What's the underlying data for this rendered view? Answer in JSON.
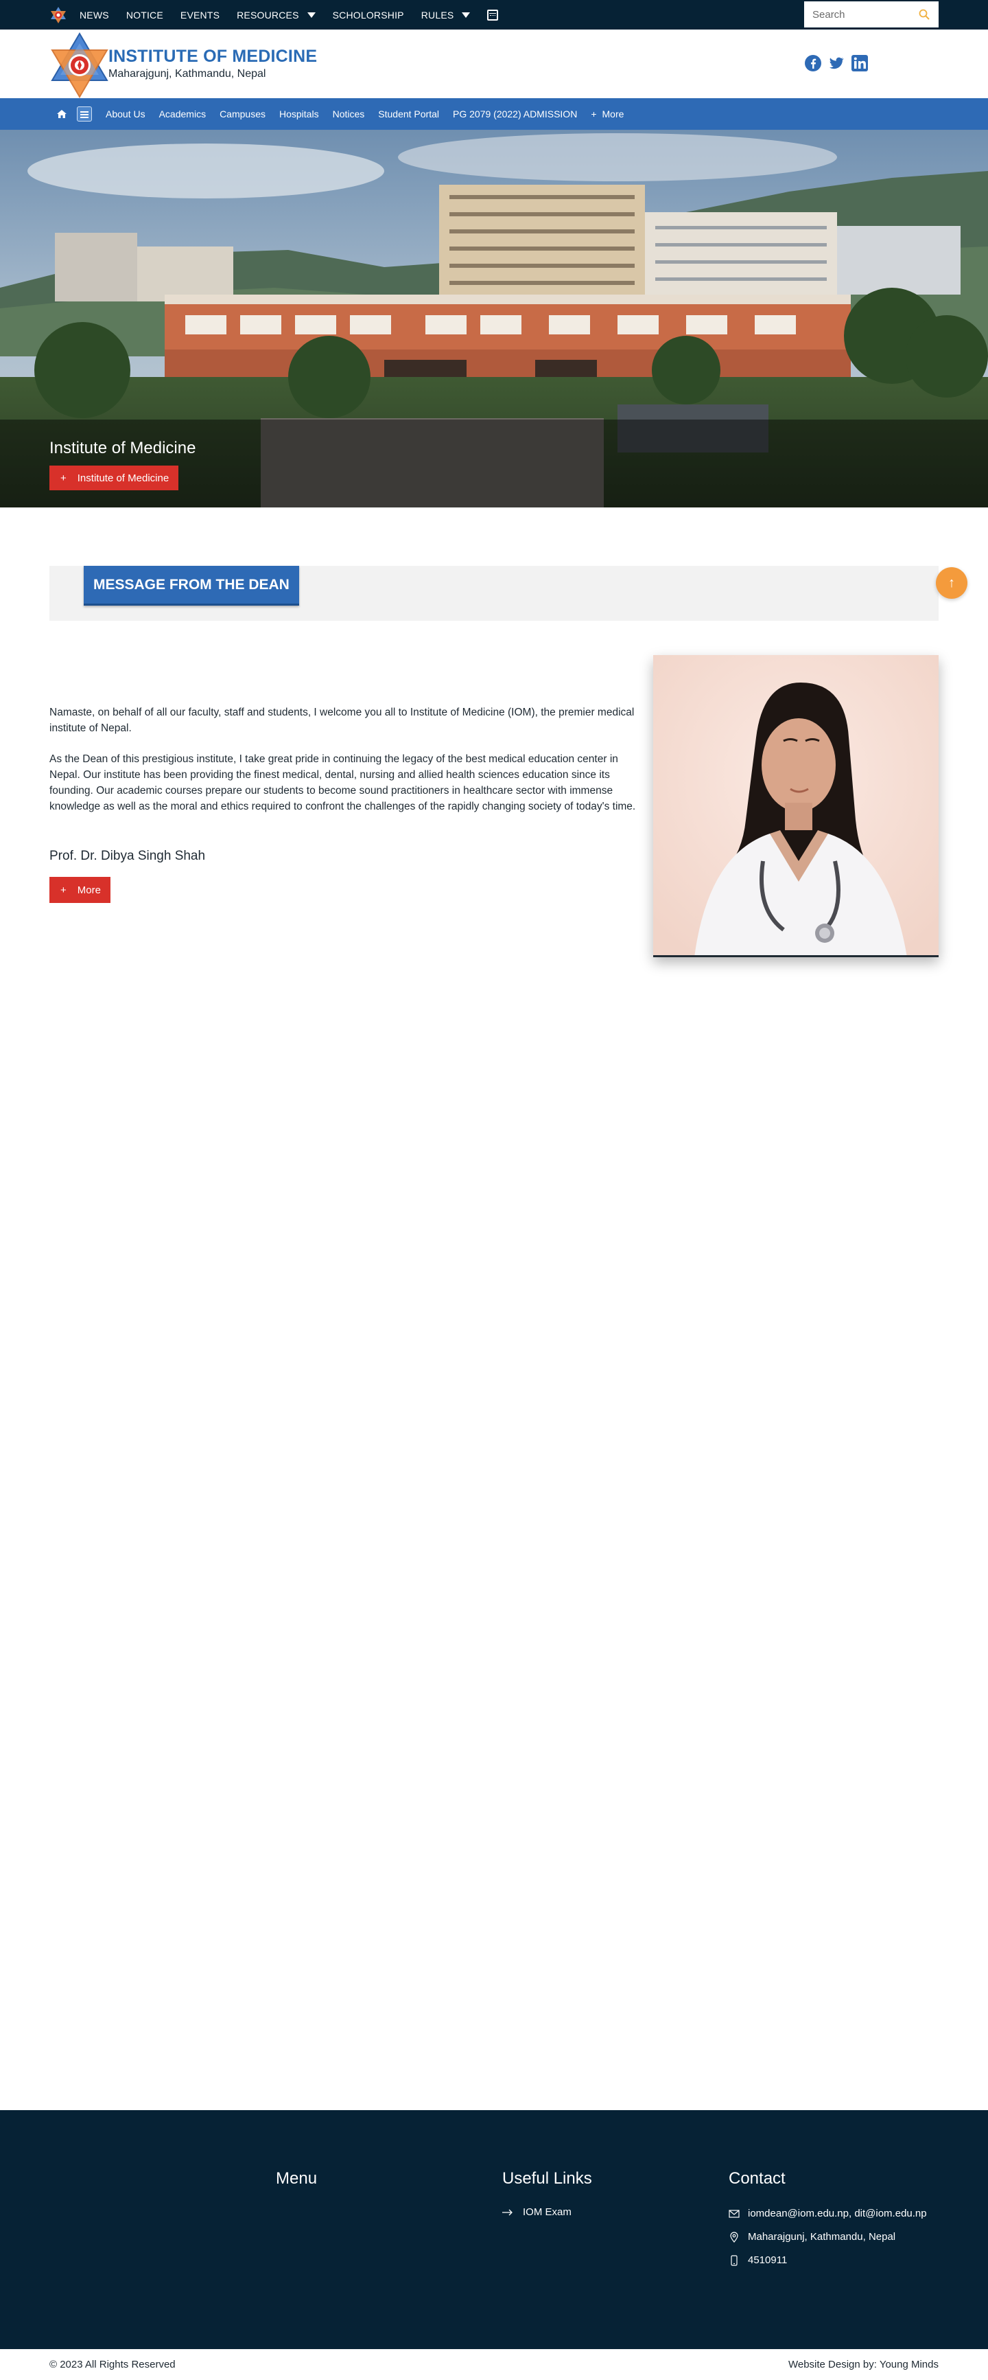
{
  "topbar": {
    "items": [
      {
        "label": "NEWS"
      },
      {
        "label": "NOTICE"
      },
      {
        "label": "EVENTS"
      },
      {
        "label": "RESOURCES",
        "dropdown": true
      },
      {
        "label": "SCHOLORSHIP"
      },
      {
        "label": "RULES",
        "dropdown": true
      }
    ],
    "calendar_icon": "calendar-icon",
    "search": {
      "placeholder": "Search",
      "value": "",
      "icon": "search-icon"
    }
  },
  "header": {
    "title": "INSTITUTE OF MEDICINE",
    "subtitle": "Maharajgunj, Kathmandu, Nepal",
    "social": [
      "facebook-icon",
      "twitter-icon",
      "linkedin-icon"
    ]
  },
  "mainnav": {
    "items": [
      {
        "label": "About Us"
      },
      {
        "label": "Academics"
      },
      {
        "label": "Campuses"
      },
      {
        "label": "Hospitals"
      },
      {
        "label": "Notices"
      },
      {
        "label": "Student Portal"
      },
      {
        "label": "PG 2079 (2022) ADMISSION"
      },
      {
        "label": "More"
      }
    ]
  },
  "hero": {
    "caption": "Institute of Medicine",
    "button": "Institute of Medicine"
  },
  "dean": {
    "heading": "MESSAGE FROM THE DEAN",
    "paragraphs": [
      "Namaste, on behalf of all our faculty, staff and students, I welcome you all to Institute of Medicine (IOM), the premier medical institute of Nepal.",
      "As the Dean of this prestigious institute, I take great pride in continuing the legacy of the best medical education center in Nepal. Our institute has been providing the finest medical, dental, nursing and allied health sciences education since its founding. Our academic courses prepare our students to become sound practitioners in healthcare sector with immense knowledge as well as the moral and ethics required to confront the challenges of the rapidly changing society of today's time."
    ],
    "name": "Prof. Dr. Dibya Singh Shah",
    "more": "More"
  },
  "scroll_top_icon": "arrow-up-icon",
  "footer": {
    "menu_title": "Menu",
    "links_title": "Useful Links",
    "links": [
      {
        "label": "IOM Exam"
      }
    ],
    "contact_title": "Contact",
    "email": "iomdean@iom.edu.np, dit@iom.edu.np",
    "address": "Maharajgunj, Kathmandu, Nepal",
    "phone": "4510911",
    "copyright": "© 2023 All Rights Reserved",
    "credit": "Website Design by: Young Minds"
  },
  "colors": {
    "topbar": "#062235",
    "brand_blue": "#2e6ab5",
    "accent_red": "#d8312a",
    "accent_orange": "#f49b3c"
  }
}
